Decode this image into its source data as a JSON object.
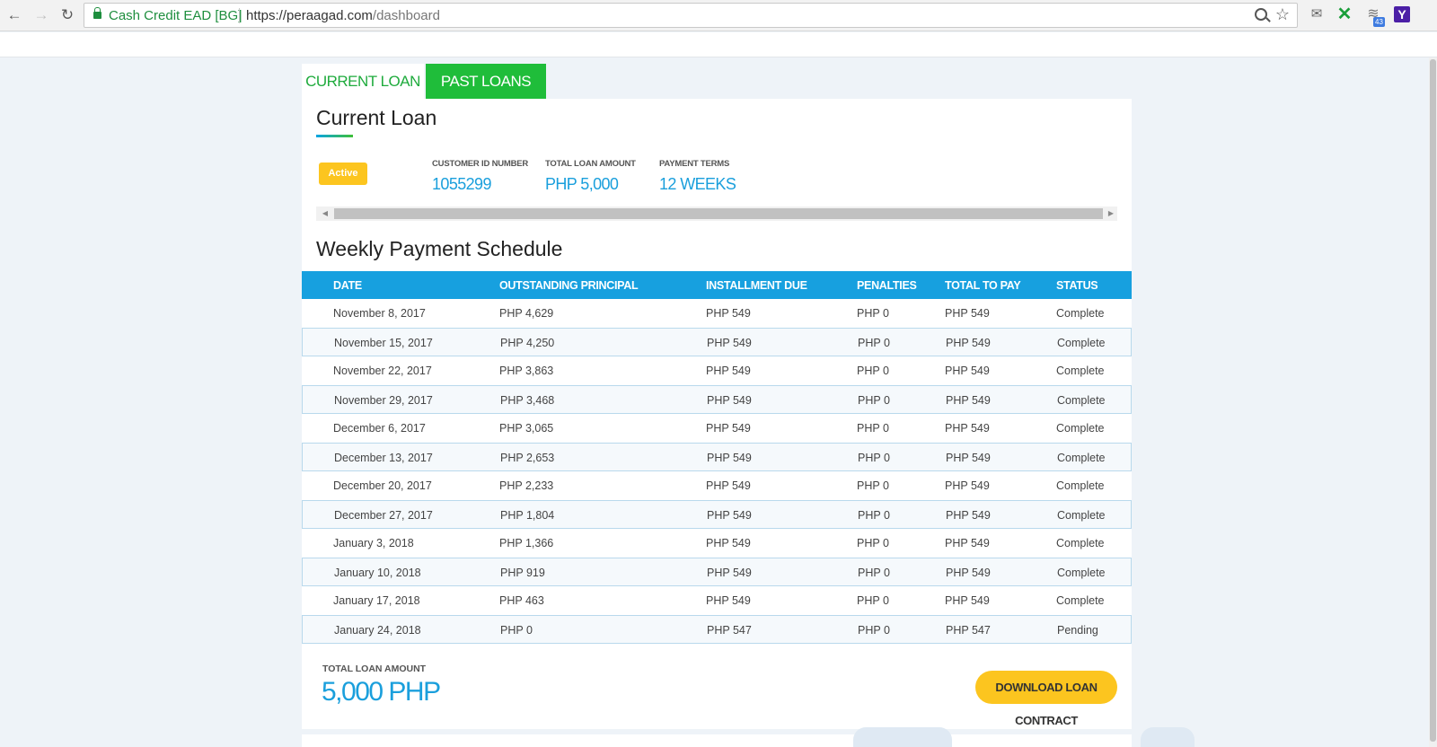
{
  "browser": {
    "site_name": "Cash Credit EAD [BG]",
    "url_host": "https://peraagad.com",
    "url_path": "/dashboard",
    "ext_badge_count": "43"
  },
  "tabs": {
    "current_label": "CURRENT LOAN",
    "past_label": "PAST LOANS"
  },
  "current_loan": {
    "title": "Current Loan",
    "status_badge": "Active",
    "customer_id_label": "CUSTOMER ID NUMBER",
    "customer_id_value": "1055299",
    "total_amount_label": "TOTAL LOAN AMOUNT",
    "total_amount_value": "PHP 5,000",
    "payment_terms_label": "PAYMENT TERMS",
    "payment_terms_value": "12 WEEKS"
  },
  "schedule": {
    "title": "Weekly Payment Schedule",
    "columns": [
      "DATE",
      "OUTSTANDING PRINCIPAL",
      "INSTALLMENT DUE",
      "PENALTIES",
      "TOTAL TO PAY",
      "STATUS"
    ],
    "rows": [
      [
        "November 8, 2017",
        "PHP 4,629",
        "PHP 549",
        "PHP 0",
        "PHP 549",
        "Complete"
      ],
      [
        "November 15, 2017",
        "PHP 4,250",
        "PHP 549",
        "PHP 0",
        "PHP 549",
        "Complete"
      ],
      [
        "November 22, 2017",
        "PHP 3,863",
        "PHP 549",
        "PHP 0",
        "PHP 549",
        "Complete"
      ],
      [
        "November 29, 2017",
        "PHP 3,468",
        "PHP 549",
        "PHP 0",
        "PHP 549",
        "Complete"
      ],
      [
        "December 6, 2017",
        "PHP 3,065",
        "PHP 549",
        "PHP 0",
        "PHP 549",
        "Complete"
      ],
      [
        "December 13, 2017",
        "PHP 2,653",
        "PHP 549",
        "PHP 0",
        "PHP 549",
        "Complete"
      ],
      [
        "December 20, 2017",
        "PHP 2,233",
        "PHP 549",
        "PHP 0",
        "PHP 549",
        "Complete"
      ],
      [
        "December 27, 2017",
        "PHP 1,804",
        "PHP 549",
        "PHP 0",
        "PHP 549",
        "Complete"
      ],
      [
        "January 3, 2018",
        "PHP 1,366",
        "PHP 549",
        "PHP 0",
        "PHP 549",
        "Complete"
      ],
      [
        "January 10, 2018",
        "PHP 919",
        "PHP 549",
        "PHP 0",
        "PHP 549",
        "Complete"
      ],
      [
        "January 17, 2018",
        "PHP 463",
        "PHP 549",
        "PHP 0",
        "PHP 549",
        "Complete"
      ],
      [
        "January 24, 2018",
        "PHP 0",
        "PHP 547",
        "PHP 0",
        "PHP 547",
        "Pending"
      ]
    ]
  },
  "footer": {
    "total_label": "TOTAL LOAN AMOUNT",
    "total_value": "5,000 PHP",
    "download_label": "DOWNLOAD LOAN CONTRACT"
  },
  "colors": {
    "accent_blue": "#17a0df",
    "accent_green": "#1fbd3a",
    "accent_yellow": "#fcc51f"
  }
}
